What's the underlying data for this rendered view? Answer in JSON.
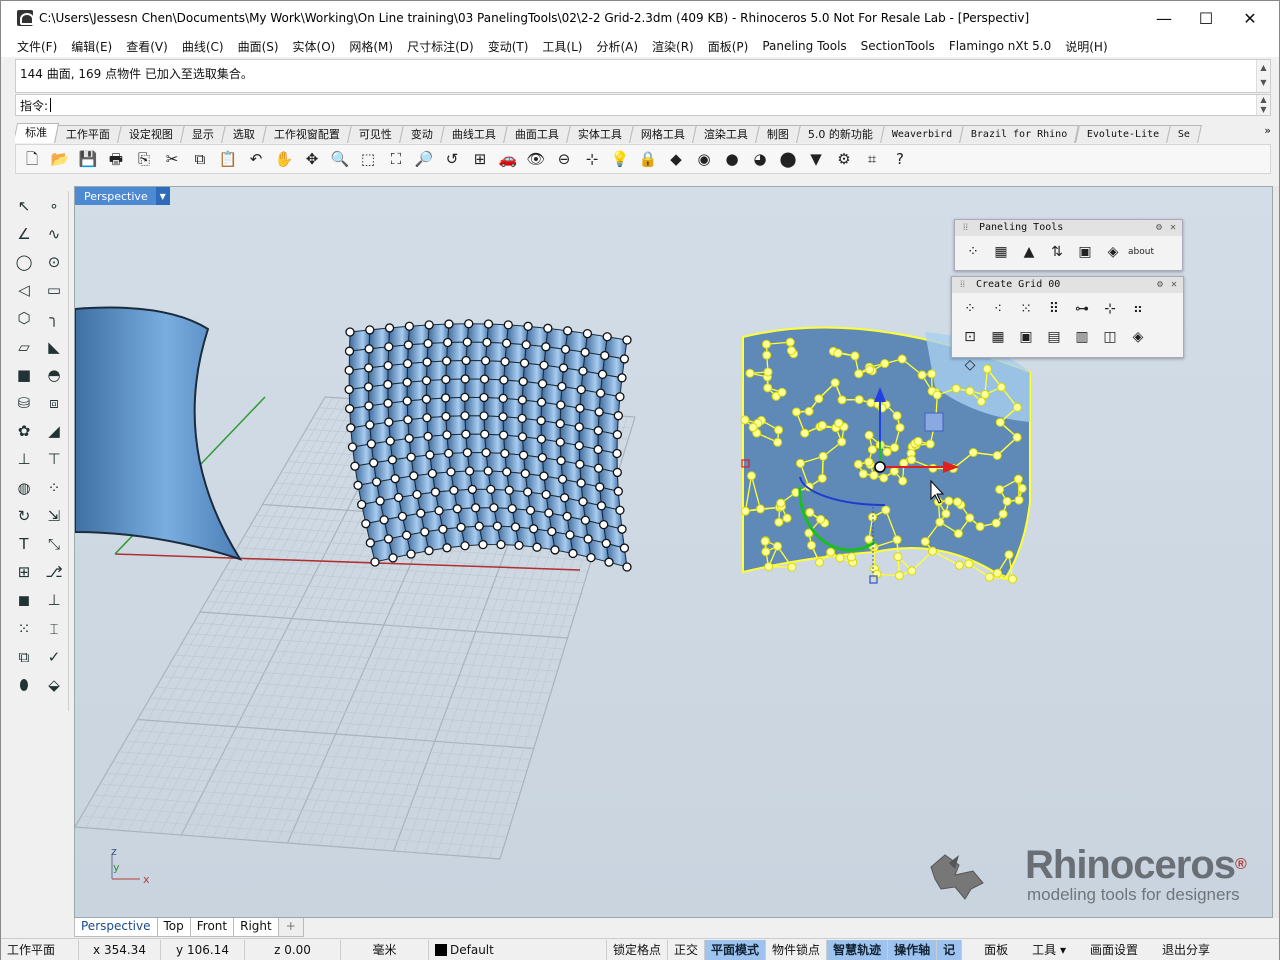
{
  "window": {
    "title": "C:\\Users\\Jessesn Chen\\Documents\\My Work\\Working\\On Line training\\03 PanelingTools\\02\\2-2 Grid-2.3dm (409 KB) - Rhinoceros 5.0 Not For Resale Lab - [Perspectiv]",
    "minimize": "—",
    "maximize": "☐",
    "close": "✕"
  },
  "menu": [
    "文件(F)",
    "编辑(E)",
    "查看(V)",
    "曲线(C)",
    "曲面(S)",
    "实体(O)",
    "网格(M)",
    "尺寸标注(D)",
    "变动(T)",
    "工具(L)",
    "分析(A)",
    "渲染(R)",
    "面板(P)",
    "Paneling Tools",
    "SectionTools",
    "Flamingo nXt 5.0",
    "说明(H)"
  ],
  "command": {
    "history_text": "144 曲面, 169 点物件 已加入至选取集合。",
    "prompt_label": "指令:",
    "prompt_value": ""
  },
  "tabs": [
    {
      "label": "标准",
      "active": true,
      "mono": false
    },
    {
      "label": "工作平面",
      "mono": false
    },
    {
      "label": "设定视图",
      "mono": false
    },
    {
      "label": "显示",
      "mono": false
    },
    {
      "label": "选取",
      "mono": false
    },
    {
      "label": "工作视窗配置",
      "mono": false
    },
    {
      "label": "可见性",
      "mono": false
    },
    {
      "label": "变动",
      "mono": false
    },
    {
      "label": "曲线工具",
      "mono": false
    },
    {
      "label": "曲面工具",
      "mono": false
    },
    {
      "label": "实体工具",
      "mono": false
    },
    {
      "label": "网格工具",
      "mono": false
    },
    {
      "label": "渲染工具",
      "mono": false
    },
    {
      "label": "制图",
      "mono": false
    },
    {
      "label": "5.0 的新功能",
      "mono": false
    },
    {
      "label": "Weaverbird",
      "mono": true
    },
    {
      "label": "Brazil for Rhino",
      "mono": true
    },
    {
      "label": "Evolute-Lite",
      "mono": true
    },
    {
      "label": "Se",
      "mono": true
    }
  ],
  "tabs_overflow": "»",
  "toolbar_icons": [
    {
      "name": "new-icon",
      "glyph": "🗋"
    },
    {
      "name": "open-icon",
      "glyph": "📂"
    },
    {
      "name": "save-icon",
      "glyph": "💾"
    },
    {
      "name": "print-icon",
      "glyph": "🖶"
    },
    {
      "name": "import-icon",
      "glyph": "⎘"
    },
    {
      "name": "cut-icon",
      "glyph": "✂"
    },
    {
      "name": "copy-icon",
      "glyph": "⧉"
    },
    {
      "name": "paste-icon",
      "glyph": "📋"
    },
    {
      "name": "undo-icon",
      "glyph": "↶"
    },
    {
      "name": "pan-hand-icon",
      "glyph": "✋"
    },
    {
      "name": "rotate-view-icon",
      "glyph": "✥"
    },
    {
      "name": "zoom-icon",
      "glyph": "🔍"
    },
    {
      "name": "zoom-window-icon",
      "glyph": "⬚"
    },
    {
      "name": "zoom-extents-icon",
      "glyph": "⛶"
    },
    {
      "name": "zoom-selected-icon",
      "glyph": "🔎"
    },
    {
      "name": "undo-view-icon",
      "glyph": "↺"
    },
    {
      "name": "viewport-layout-icon",
      "glyph": "⊞"
    },
    {
      "name": "car-icon",
      "glyph": "🚗"
    },
    {
      "name": "camera-eye-icon",
      "glyph": "👁"
    },
    {
      "name": "target-icon",
      "glyph": "⊖"
    },
    {
      "name": "cplane-icon",
      "glyph": "⊹"
    },
    {
      "name": "light-icon",
      "glyph": "💡"
    },
    {
      "name": "lock-icon",
      "glyph": "🔒"
    },
    {
      "name": "layer-icon",
      "glyph": "◆"
    },
    {
      "name": "color-wheel-icon",
      "glyph": "◉"
    },
    {
      "name": "shaded-sphere-icon",
      "glyph": "●"
    },
    {
      "name": "rendered-sphere-icon",
      "glyph": "◕"
    },
    {
      "name": "render-icon",
      "glyph": "⬤"
    },
    {
      "name": "filter-icon",
      "glyph": "▼"
    },
    {
      "name": "settings-gear-icon",
      "glyph": "⚙"
    },
    {
      "name": "snap-icon",
      "glyph": "⌗"
    },
    {
      "name": "help-icon",
      "glyph": "?"
    }
  ],
  "left_tools": [
    {
      "name": "select-arrow-icon",
      "glyph": "↖"
    },
    {
      "name": "point-icon",
      "glyph": "∘"
    },
    {
      "name": "polyline-icon",
      "glyph": "∠"
    },
    {
      "name": "curve-icon",
      "glyph": "∿"
    },
    {
      "name": "circle-icon",
      "glyph": "◯"
    },
    {
      "name": "ellipse-icon",
      "glyph": "⊙"
    },
    {
      "name": "arc-icon",
      "glyph": "◁"
    },
    {
      "name": "rectangle-icon",
      "glyph": "▭"
    },
    {
      "name": "polygon-icon",
      "glyph": "⬡"
    },
    {
      "name": "fillet-icon",
      "glyph": "╮"
    },
    {
      "name": "surface-icon",
      "glyph": "▱"
    },
    {
      "name": "loft-icon",
      "glyph": "◣"
    },
    {
      "name": "box-icon",
      "glyph": "■"
    },
    {
      "name": "boolean-icon",
      "glyph": "◓"
    },
    {
      "name": "cylinder-icon",
      "glyph": "⛁"
    },
    {
      "name": "extrude-icon",
      "glyph": "⧈"
    },
    {
      "name": "mesh-icon",
      "glyph": "✿"
    },
    {
      "name": "sweep-icon",
      "glyph": "◢"
    },
    {
      "name": "move-icon",
      "glyph": "⊥"
    },
    {
      "name": "align-icon",
      "glyph": "⊤"
    },
    {
      "name": "group-icon",
      "glyph": "◍"
    },
    {
      "name": "points-icon",
      "glyph": "⁘"
    },
    {
      "name": "rotate-icon",
      "glyph": "↻"
    },
    {
      "name": "scale-icon",
      "glyph": "⇲"
    },
    {
      "name": "text-icon",
      "glyph": "T"
    },
    {
      "name": "dimension-icon",
      "glyph": "⤡"
    },
    {
      "name": "array-icon",
      "glyph": "⊞"
    },
    {
      "name": "analyze-icon",
      "glyph": "⎇"
    },
    {
      "name": "solid-box-icon",
      "glyph": "◼"
    },
    {
      "name": "ruler-icon",
      "glyph": "⊥"
    },
    {
      "name": "grid-icon",
      "glyph": "⁙"
    },
    {
      "name": "cplane-vert-icon",
      "glyph": "⌶"
    },
    {
      "name": "layers-icon",
      "glyph": "⧉"
    },
    {
      "name": "check-icon",
      "glyph": "✓"
    },
    {
      "name": "render-mat-icon",
      "glyph": "⬮"
    },
    {
      "name": "paint-icon",
      "glyph": "⬙"
    }
  ],
  "viewport": {
    "label": "Perspective",
    "dropdown": "▼"
  },
  "panels": [
    {
      "title": "Paneling Tools",
      "icons": [
        {
          "name": "grid-points-icon",
          "glyph": "⁘"
        },
        {
          "name": "grid-create-icon",
          "glyph": "▦"
        },
        {
          "name": "triangle-panel-icon",
          "glyph": "▲"
        },
        {
          "name": "paneling-curve-icon",
          "glyph": "⇅"
        },
        {
          "name": "panel-box-icon",
          "glyph": "▣"
        },
        {
          "name": "panel-diamond-icon",
          "glyph": "◈"
        },
        {
          "name": "about-icon",
          "glyph": "about"
        }
      ]
    },
    {
      "title": "Create Grid 00",
      "icons": [
        {
          "name": "grid-4-icon",
          "glyph": "⁘"
        },
        {
          "name": "grid-polar-icon",
          "glyph": "⁖"
        },
        {
          "name": "grid-dots-icon",
          "glyph": "⁙"
        },
        {
          "name": "grid-curve-icon",
          "glyph": "⠿"
        },
        {
          "name": "grid-line-icon",
          "glyph": "⊶"
        },
        {
          "name": "grid-cross-icon",
          "glyph": "⊹"
        },
        {
          "name": "grid-small-icon",
          "glyph": "⠶"
        },
        {
          "name": "grid-frame-icon",
          "glyph": "⊡"
        },
        {
          "name": "grid-box-a-icon",
          "glyph": "▦"
        },
        {
          "name": "grid-box-b-icon",
          "glyph": "▣"
        },
        {
          "name": "grid-box-c-icon",
          "glyph": "▤"
        },
        {
          "name": "grid-box-d-icon",
          "glyph": "▥"
        },
        {
          "name": "grid-box-e-icon",
          "glyph": "◫"
        },
        {
          "name": "grid-box-f-icon",
          "glyph": "◈"
        },
        {
          "name": "grid-box-g-icon",
          "glyph": "◇"
        }
      ]
    }
  ],
  "panel_controls": {
    "gear": "⚙",
    "close": "✕"
  },
  "axis_labels": {
    "x": "x",
    "y": "y",
    "z": "z"
  },
  "watermark": {
    "brand": "Rhinoceros",
    "trademark": "®",
    "tagline": "modeling tools for designers"
  },
  "viewport_tabs": [
    "Perspective",
    "Top",
    "Front",
    "Right"
  ],
  "add_tab": "+",
  "status": {
    "cplane": "工作平面",
    "x": "x 354.34",
    "y": "y 106.14",
    "z": "z 0.00",
    "units": "毫米",
    "layer": "Default",
    "toggles": [
      {
        "label": "锁定格点",
        "on": false
      },
      {
        "label": "正交",
        "on": false
      },
      {
        "label": "平面模式",
        "on": true
      },
      {
        "label": "物件锁点",
        "on": false
      },
      {
        "label": "智慧轨迹",
        "on": true
      },
      {
        "label": "操作轴",
        "on": true
      },
      {
        "label": "记",
        "on": true
      }
    ],
    "right_menu": [
      "面板",
      "工具 ▾",
      "画面设置",
      "退出分享"
    ]
  },
  "colors": {
    "surface_blue": "#6a98c8",
    "selection_yellow": "#ffff33",
    "viewport_tab_blue": "#4d8ad3",
    "x_axis_red": "#b03030",
    "y_axis_green": "#2f9a2f",
    "toggle_on": "#9ec3ef"
  }
}
